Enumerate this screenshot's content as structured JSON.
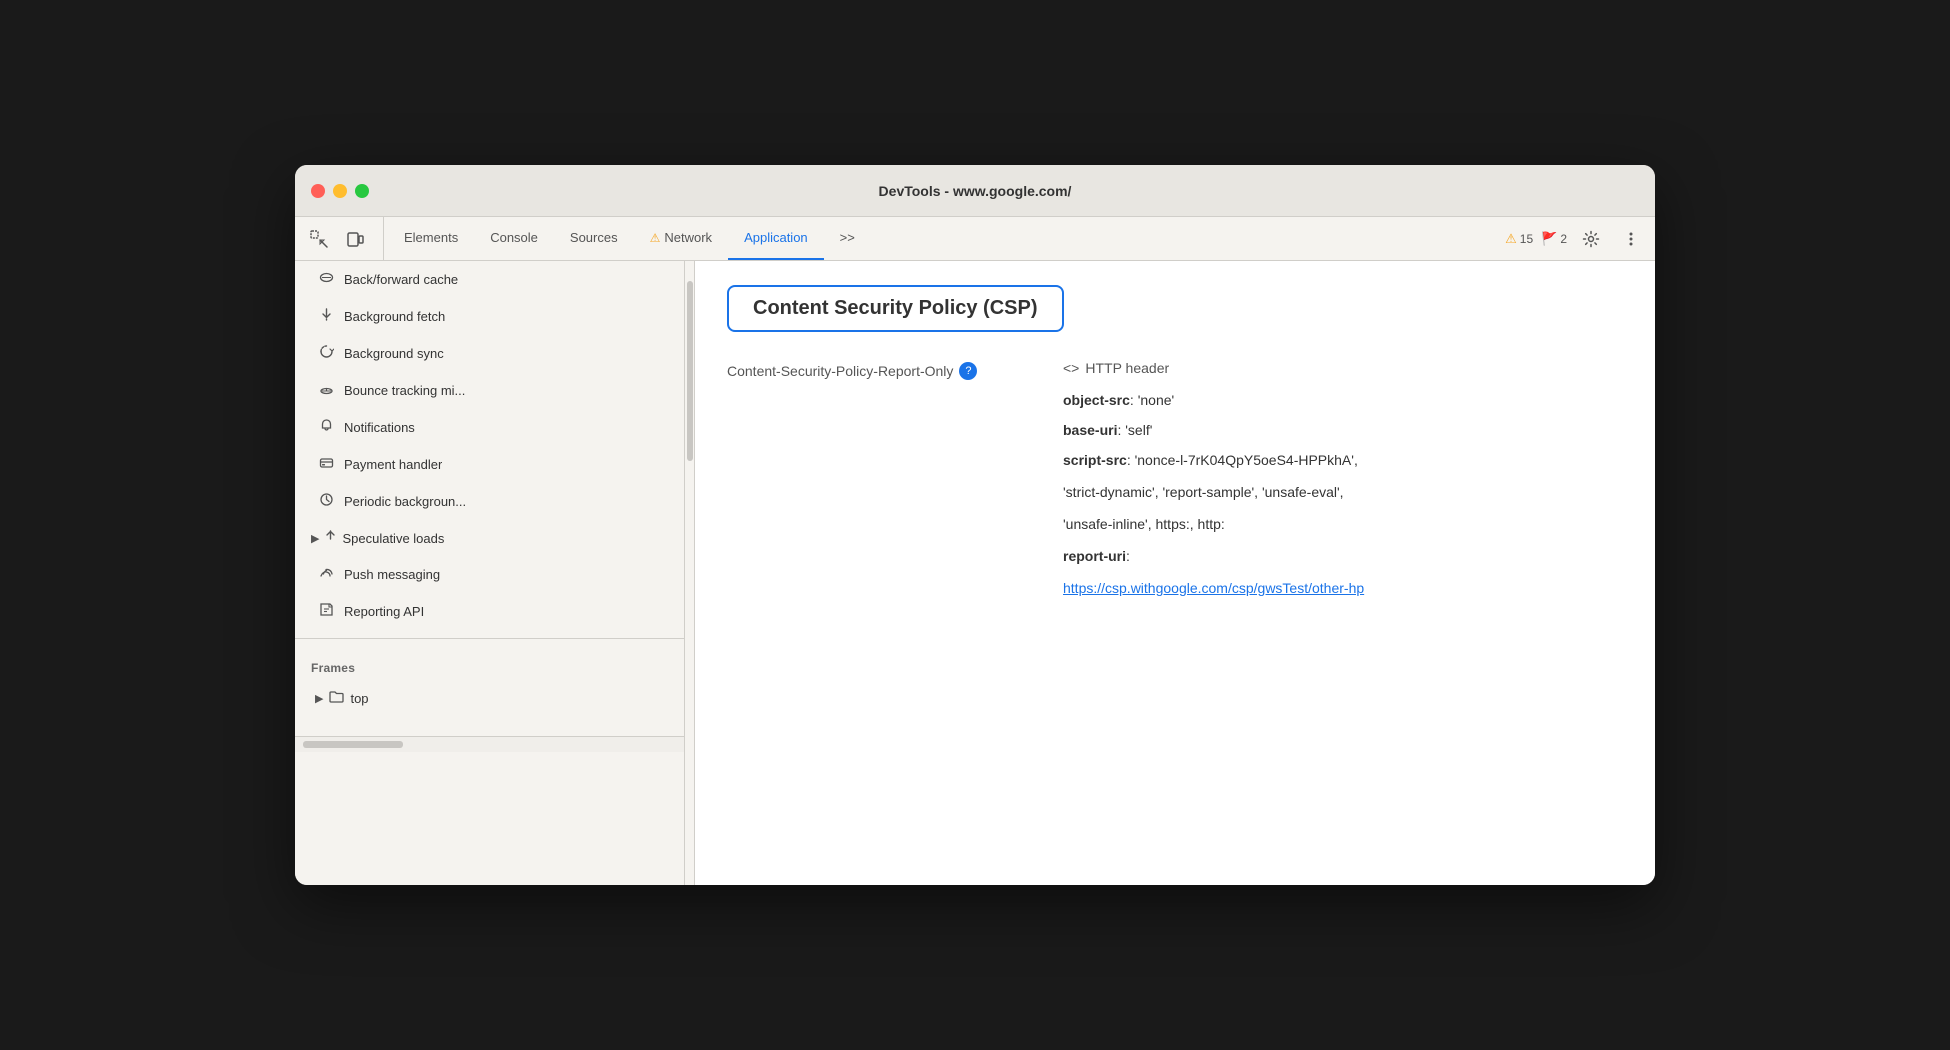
{
  "window": {
    "title": "DevTools - www.google.com/"
  },
  "toolbar": {
    "tabs": [
      {
        "id": "elements",
        "label": "Elements",
        "active": false,
        "warning": false
      },
      {
        "id": "console",
        "label": "Console",
        "active": false,
        "warning": false
      },
      {
        "id": "sources",
        "label": "Sources",
        "active": false,
        "warning": false
      },
      {
        "id": "network",
        "label": "Network",
        "active": false,
        "warning": true
      },
      {
        "id": "application",
        "label": "Application",
        "active": true,
        "warning": false
      }
    ],
    "more_tabs": ">>",
    "warn_count": "15",
    "err_count": "2"
  },
  "sidebar": {
    "items": [
      {
        "id": "back-forward-cache",
        "icon": "🗄",
        "label": "Back/forward cache"
      },
      {
        "id": "background-fetch",
        "icon": "↕",
        "label": "Background fetch"
      },
      {
        "id": "background-sync",
        "icon": "↺",
        "label": "Background sync"
      },
      {
        "id": "bounce-tracking",
        "icon": "🗄",
        "label": "Bounce tracking mi..."
      },
      {
        "id": "notifications",
        "icon": "🔔",
        "label": "Notifications"
      },
      {
        "id": "payment-handler",
        "icon": "💳",
        "label": "Payment handler"
      },
      {
        "id": "periodic-background",
        "icon": "🕐",
        "label": "Periodic backgroun..."
      },
      {
        "id": "speculative-loads",
        "icon": "↕",
        "label": "Speculative loads",
        "expandable": true
      },
      {
        "id": "push-messaging",
        "icon": "☁",
        "label": "Push messaging"
      },
      {
        "id": "reporting-api",
        "icon": "📄",
        "label": "Reporting API"
      }
    ],
    "frames_section": "Frames",
    "frames_top": "top"
  },
  "main": {
    "csp_title": "Content Security Policy (CSP)",
    "policy_name": "Content-Security-Policy-Report-Only",
    "header_label": "HTTP header",
    "directives": [
      {
        "key": "object-src",
        "value": "'none'"
      },
      {
        "key": "base-uri",
        "value": "'self'"
      },
      {
        "key": "script-src",
        "value": "'nonce-l-7rK04QpY5oeS4-HPPkhA', 'strict-dynamic', 'report-sample', 'unsafe-eval', 'unsafe-inline', https:, http:"
      },
      {
        "key": "report-uri",
        "value": ""
      },
      {
        "key": "report_uri_value",
        "value": "https://csp.withgoogle.com/csp/gwsTest/other-hp"
      }
    ]
  }
}
